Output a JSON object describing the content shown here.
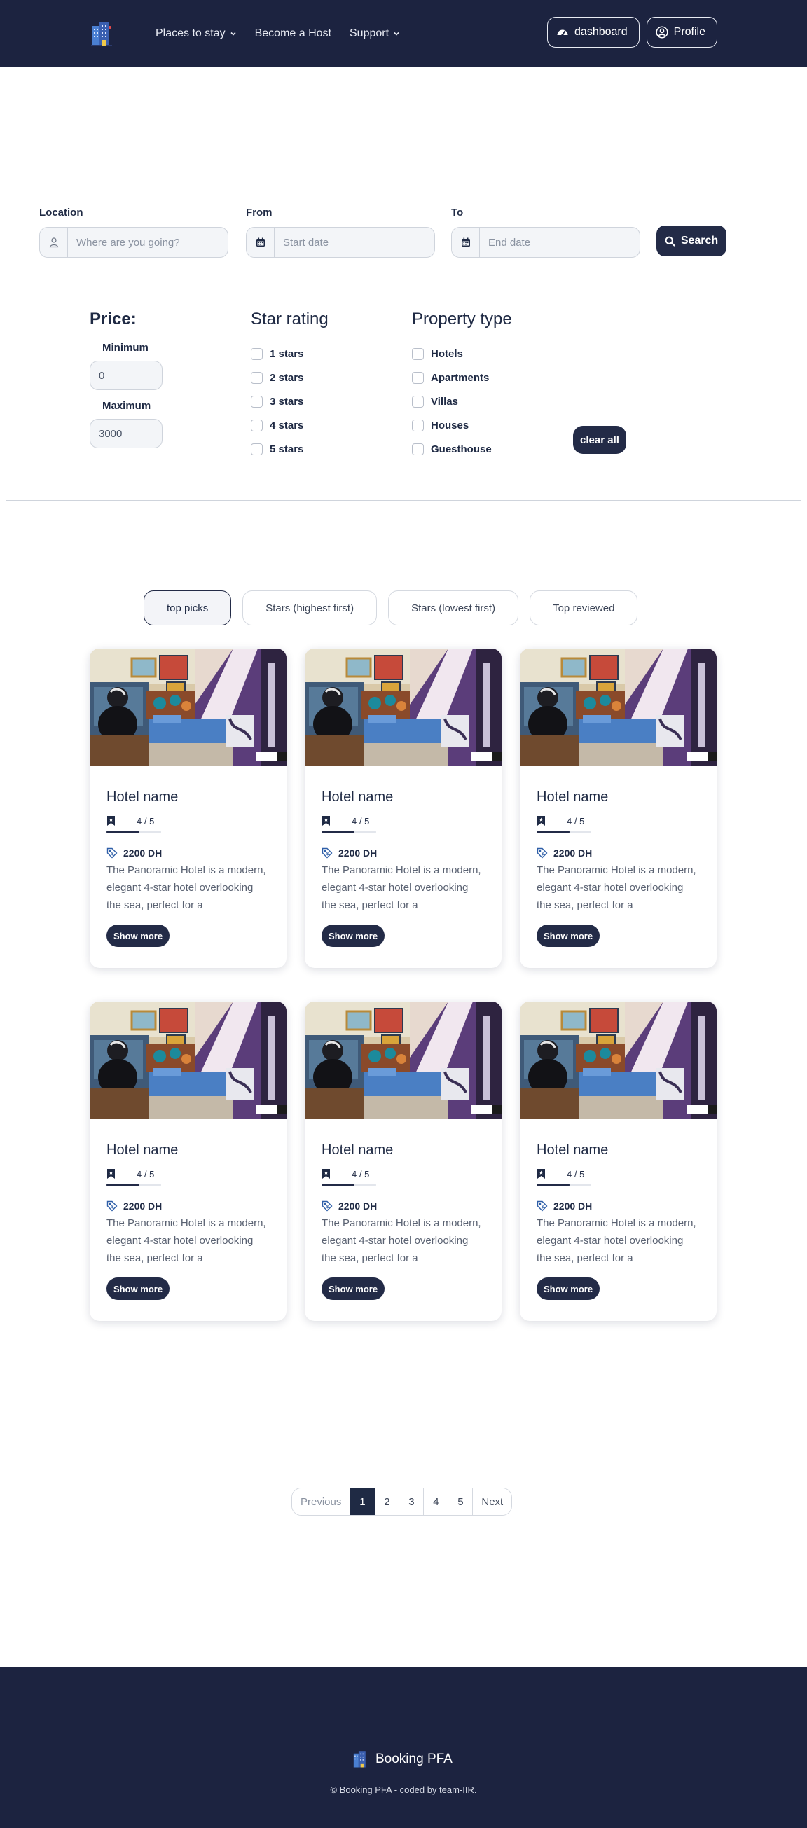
{
  "nav": {
    "brand_icon": "hotel-building-icon",
    "links": [
      "Places to stay",
      "Become a Host",
      "Support"
    ],
    "dashboard_label": "dashboard",
    "profile_label": "Profile"
  },
  "search": {
    "location_label": "Location",
    "location_placeholder": "Where are you going?",
    "from_label": "From",
    "from_placeholder": "Start date",
    "to_label": "To",
    "to_placeholder": "End date",
    "search_label": "Search"
  },
  "filters": {
    "price_title": "Price:",
    "minimum_label": "Minimum",
    "minimum_value": "0",
    "maximum_label": "Maximum",
    "maximum_value": "3000",
    "star_title": "Star rating",
    "stars": [
      "1 stars",
      "2 stars",
      "3 stars",
      "4 stars",
      "5 stars"
    ],
    "property_title": "Property type",
    "properties": [
      "Hotels",
      "Apartments",
      "Villas",
      "Houses",
      "Guesthouse"
    ],
    "clear_label": "clear all"
  },
  "sort_tabs": [
    "top picks",
    "Stars (highest first)",
    "Stars (lowest first)",
    "Top reviewed"
  ],
  "active_sort": 0,
  "hotels": [
    {
      "name": "Hotel name",
      "rating_text": "4 / 5",
      "rating": 0.6,
      "price": "2200 DH",
      "description": "The Panoramic Hotel is a modern, elegant 4-star hotel overlooking the sea, perfect for a",
      "button": "Show more"
    },
    {
      "name": "Hotel name",
      "rating_text": "4 / 5",
      "rating": 0.6,
      "price": "2200 DH",
      "description": "The Panoramic Hotel is a modern, elegant 4-star hotel overlooking the sea, perfect for a",
      "button": "Show more"
    },
    {
      "name": "Hotel name",
      "rating_text": "4 / 5",
      "rating": 0.6,
      "price": "2200 DH",
      "description": "The Panoramic Hotel is a modern, elegant 4-star hotel overlooking the sea, perfect for a",
      "button": "Show more"
    },
    {
      "name": "Hotel name",
      "rating_text": "4 / 5",
      "rating": 0.6,
      "price": "2200 DH",
      "description": "The Panoramic Hotel is a modern, elegant 4-star hotel overlooking the sea, perfect for a",
      "button": "Show more"
    },
    {
      "name": "Hotel name",
      "rating_text": "4 / 5",
      "rating": 0.6,
      "price": "2200 DH",
      "description": "The Panoramic Hotel is a modern, elegant 4-star hotel overlooking the sea, perfect for a",
      "button": "Show more"
    },
    {
      "name": "Hotel name",
      "rating_text": "4 / 5",
      "rating": 0.6,
      "price": "2200 DH",
      "description": "The Panoramic Hotel is a modern, elegant 4-star hotel overlooking the sea, perfect for a",
      "button": "Show more"
    }
  ],
  "pagination": {
    "previous": "Previous",
    "pages": [
      "1",
      "2",
      "3",
      "4",
      "5"
    ],
    "active": "1",
    "next": "Next"
  },
  "footer": {
    "brand": "Booking PFA",
    "copyright": "© Booking PFA - coded by team-IIR."
  },
  "colors": {
    "navy": "#1c2340",
    "button": "#232b47"
  }
}
